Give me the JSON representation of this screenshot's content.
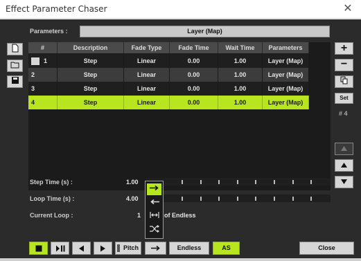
{
  "window": {
    "title": "Effect Parameter Chaser"
  },
  "parameters": {
    "label": "Parameters :",
    "value": "Layer (Map)"
  },
  "table": {
    "columns": [
      "#",
      "Description",
      "Fade Type",
      "Fade Time",
      "Wait Time",
      "Parameters"
    ],
    "rows": [
      {
        "num": "1",
        "desc": "Step",
        "fade_type": "Linear",
        "fade_time": "0.00",
        "wait_time": "1.00",
        "params": "Layer (Map)"
      },
      {
        "num": "2",
        "desc": "Step",
        "fade_type": "Linear",
        "fade_time": "0.00",
        "wait_time": "1.00",
        "params": "Layer (Map)"
      },
      {
        "num": "3",
        "desc": "Step",
        "fade_type": "Linear",
        "fade_time": "0.00",
        "wait_time": "1.00",
        "params": "Layer (Map)"
      },
      {
        "num": "4",
        "desc": "Step",
        "fade_type": "Linear",
        "fade_time": "0.00",
        "wait_time": "1.00",
        "params": "Layer (Map)"
      }
    ],
    "selected_row": 4
  },
  "right_panel": {
    "set_label": "Set",
    "selected_step": "# 4"
  },
  "step_time": {
    "label": "Step Time (s) :",
    "value": "1.00"
  },
  "loop_time": {
    "label": "Loop Time (s) :",
    "value": "4.00"
  },
  "current_loop": {
    "label": "Current Loop :",
    "value": "1",
    "suffix": "of Endless"
  },
  "bottom": {
    "pitch": "Pitch",
    "endless": "Endless",
    "as": "AS",
    "close": "Close"
  },
  "colors": {
    "accent": "#b7e61f",
    "background": "#2b2b2b"
  },
  "icons": {
    "left": [
      "new-document-icon",
      "open-folder-icon",
      "save-disk-icon"
    ],
    "right": [
      "plus-icon",
      "minus-icon",
      "copy-icon",
      "move-up-icon",
      "move-up-icon",
      "move-down-icon"
    ],
    "playback": [
      "stop-icon",
      "play-pause-icon",
      "previous-icon",
      "next-icon"
    ],
    "direction_menu": [
      "forward-arrow-icon",
      "backward-arrow-icon",
      "bounce-icon",
      "random-icon"
    ]
  }
}
